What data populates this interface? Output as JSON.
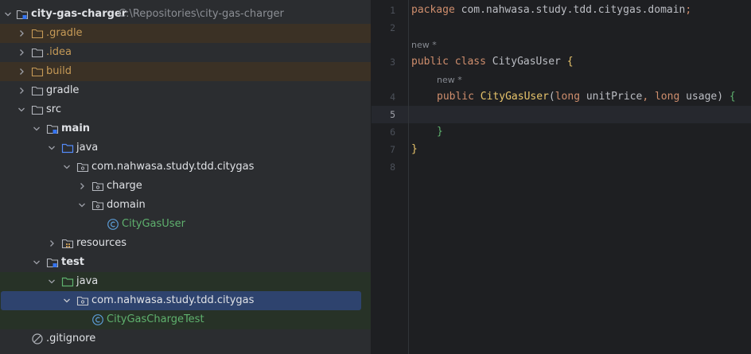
{
  "tree": {
    "root": {
      "name": "city-gas-charger",
      "path": "C:\\Repositories\\city-gas-charger"
    },
    "items": [
      {
        "label": ".gradle"
      },
      {
        "label": ".idea"
      },
      {
        "label": "build"
      },
      {
        "label": "gradle"
      },
      {
        "label": "src"
      },
      {
        "label": "main"
      },
      {
        "label": "java"
      },
      {
        "label": "com.nahwasa.study.tdd.citygas"
      },
      {
        "label": "charge"
      },
      {
        "label": "domain"
      },
      {
        "label": "CityGasUser"
      },
      {
        "label": "resources"
      },
      {
        "label": "test"
      },
      {
        "label": "java"
      },
      {
        "label": "com.nahwasa.study.tdd.citygas"
      },
      {
        "label": "CityGasChargeTest"
      },
      {
        "label": ".gitignore"
      }
    ]
  },
  "editor": {
    "line_numbers": [
      "1",
      "2",
      "3",
      "4",
      "5",
      "6",
      "7",
      "8"
    ],
    "hints": [
      "new *",
      "new *"
    ],
    "tokens": {
      "package_kw": "package",
      "package_name": "com.nahwasa.study.tdd.citygas.domain",
      "semicolon": ";",
      "public_kw": "public",
      "class_kw": "class",
      "class_name": "CityGasUser",
      "open_brace": "{",
      "close_brace": "}",
      "ctor_name": "CityGasUser",
      "long_kw": "long",
      "param1": "unitPrice",
      "param2": "usage",
      "paren_open": "(",
      "paren_close": ")",
      "comma": ","
    }
  },
  "colors": {
    "tree_bg": "#2b2d30",
    "editor_bg": "#1e1f22",
    "excluded_row": "#3b3125",
    "test_row": "#273227",
    "selected_row": "#2e436e",
    "keyword": "#cf8e6d",
    "class_name": "#bcbec4",
    "constructor": "#e8c46b",
    "class_icon": "#5b9bd5"
  },
  "icons": [
    "chevron-down-icon",
    "chevron-right-icon",
    "module-icon",
    "folder-icon",
    "source-folder-icon",
    "test-source-folder-icon",
    "package-icon",
    "class-icon",
    "gitignore-icon"
  ]
}
